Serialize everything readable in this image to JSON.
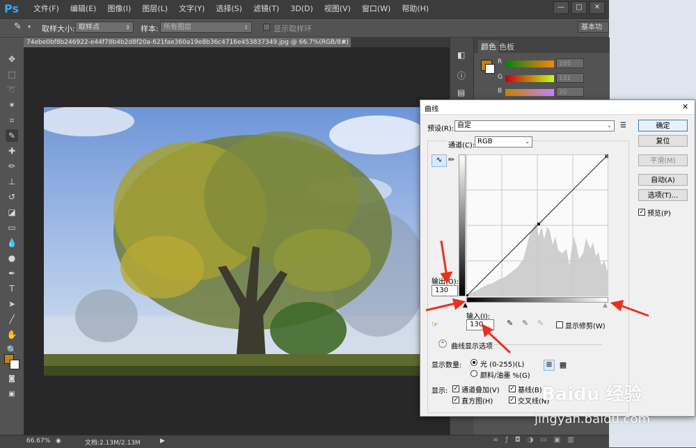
{
  "app": {
    "logo": "Ps"
  },
  "menu": [
    "文件(F)",
    "编辑(E)",
    "图像(I)",
    "图层(L)",
    "文字(Y)",
    "选择(S)",
    "滤镜(T)",
    "3D(D)",
    "视图(V)",
    "窗口(W)",
    "帮助(H)"
  ],
  "options_bar": {
    "sample_size_label": "取样大小:",
    "sample_size_value": "取样点",
    "sample_label": "样本:",
    "sample_value": "所有图层",
    "show_ring_label": "显示取样环",
    "workspace": "基本功能"
  },
  "document": {
    "tab_title": "74ebe0bf8b246922-e44f78b4b2d8f20a-621fae360a19e8b36c4716e453837349.jpg @ 66.7%(RGB/8#)",
    "tab_close": "×"
  },
  "status": {
    "zoom": "66.67%",
    "doc": "文档:2.13M/2.13M"
  },
  "color_panel": {
    "tabs": [
      "颜色",
      "色板"
    ],
    "r_label": "R",
    "g_label": "G",
    "b_label": "B",
    "r_value": "195",
    "g_value": "131",
    "b_value": "20",
    "fg_color": "#c3830f",
    "bg_color": "#ffffff"
  },
  "curves": {
    "title": "曲线",
    "close": "✕",
    "preset_label": "预设(R):",
    "preset_value": "自定",
    "channel_label": "通道(C):",
    "channel_value": "RGB",
    "output_label": "输出(O):",
    "output_value": "130",
    "input_label": "输入(I):",
    "input_value": "130",
    "show_clipping": "显示修剪(W)",
    "display_options": "曲线显示选项",
    "show_amount_label": "显示数量:",
    "light_option": "光 (0-255)(L)",
    "pigment_option": "颜料/油墨 %(G)",
    "show_label": "显示:",
    "channel_overlay": "通道叠加(V)",
    "baseline": "基线(B)",
    "histogram": "直方图(H)",
    "intersection": "交叉线(N)",
    "buttons": {
      "ok": "确定",
      "reset": "复位",
      "smooth": "平滑(M)",
      "auto": "自动(A)",
      "options": "选项(T)...",
      "preview": "预览(P)"
    }
  },
  "watermark": {
    "brand": "Baidu 经验",
    "url": "jingyan.baidu.com"
  },
  "colors": {
    "accent_red": "#e8321e",
    "dialog_bg": "#f0f0f0",
    "ui_dark": "#535353"
  }
}
